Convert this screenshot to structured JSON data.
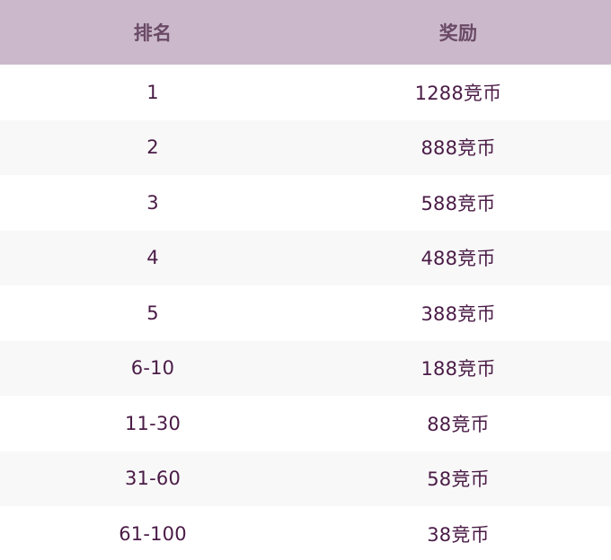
{
  "table": {
    "headers": {
      "rank": "排名",
      "reward": "奖励"
    },
    "rows": [
      {
        "rank": "1",
        "reward": "1288竞币"
      },
      {
        "rank": "2",
        "reward": "888竞币"
      },
      {
        "rank": "3",
        "reward": "588竞币"
      },
      {
        "rank": "4",
        "reward": "488竞币"
      },
      {
        "rank": "5",
        "reward": "388竞币"
      },
      {
        "rank": "6-10",
        "reward": "188竞币"
      },
      {
        "rank": "11-30",
        "reward": "88竞币"
      },
      {
        "rank": "31-60",
        "reward": "58竞币"
      },
      {
        "rank": "61-100",
        "reward": "38竞币"
      }
    ]
  },
  "colors": {
    "header_bg": "#cbb9cb",
    "header_text": "#6a4a66",
    "row_text": "#4a1b46",
    "row_alt_bg": "#f8f8f8",
    "row_bg": "#ffffff"
  }
}
